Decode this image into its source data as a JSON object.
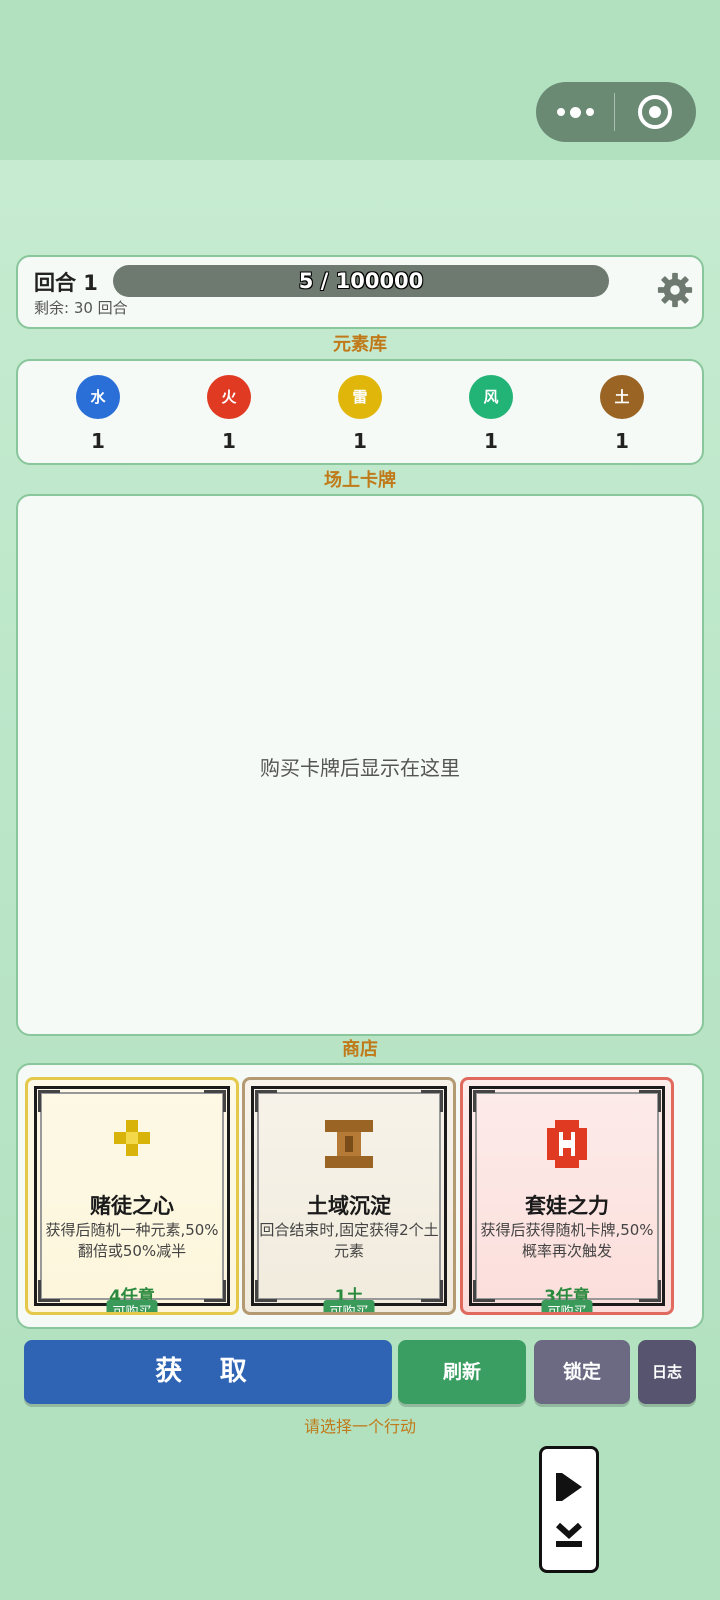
{
  "round": {
    "label": "回合 1",
    "progress_text": "5 / 100000",
    "progress_fraction": 5e-05,
    "remaining": "剩余: 30 回合",
    "settings_icon": "gear-icon"
  },
  "elements": {
    "title": "元素库",
    "items": [
      {
        "name": "水",
        "count": "1",
        "color": "#2a6fd8"
      },
      {
        "name": "火",
        "count": "1",
        "color": "#e03a22"
      },
      {
        "name": "雷",
        "count": "1",
        "color": "#e0b60a"
      },
      {
        "name": "风",
        "count": "1",
        "color": "#22b377"
      },
      {
        "name": "土",
        "count": "1",
        "color": "#9a6424"
      }
    ]
  },
  "field": {
    "title": "场上卡牌",
    "empty_text": "购买卡牌后显示在这里"
  },
  "shop": {
    "title": "商店",
    "cards": [
      {
        "name": "赌徒之心",
        "desc": "获得后随机一种元素,50%翻倍或50%减半",
        "cost": "4任意",
        "buy": "可购买",
        "icon": "gold-cross-icon"
      },
      {
        "name": "土域沉淀",
        "desc": "回合结束时,固定获得2个土元素",
        "cost": "1土",
        "buy": "可购买",
        "icon": "earth-pillar-icon"
      },
      {
        "name": "套娃之力",
        "desc": "获得后获得随机卡牌,50%概率再次触发",
        "cost": "3任意",
        "buy": "可购买",
        "icon": "red-ring-icon"
      }
    ]
  },
  "actions": {
    "get": "获 取",
    "refresh": "刷新",
    "lock": "锁定",
    "log": "日志",
    "hint": "请选择一个行动"
  },
  "colors": {
    "background": "#b2e1c0",
    "accent_title": "#c07a1a",
    "get_button": "#2f64b5",
    "refresh_button": "#3a9e62",
    "lock_button": "#6b6a82",
    "log_button": "#56546e"
  }
}
